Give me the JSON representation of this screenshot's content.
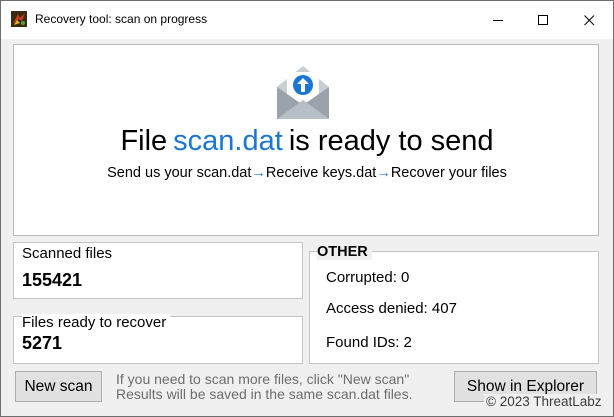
{
  "window": {
    "title": "Recovery tool: scan on progress"
  },
  "icons": {
    "app": "app-logo-icon",
    "minimize": "minimize-icon",
    "maximize": "maximize-icon",
    "close": "close-icon",
    "hero": "envelope-upload-icon"
  },
  "colors": {
    "accent": "#1a76d2",
    "window_bg": "#f0f0f0",
    "panel_bg": "#ffffff"
  },
  "hero": {
    "headline_prefix": "File",
    "filename": "scan.dat",
    "headline_suffix": "is ready to send",
    "step_1": "Send us your scan.dat",
    "arrow_1": "→",
    "step_2": "Receive keys.dat",
    "arrow_2": "→",
    "step_3": "Recover your files"
  },
  "stats": {
    "scanned_label": "Scanned files",
    "scanned_value": "155421",
    "ready_label": "Files ready to recover",
    "ready_value": "5271"
  },
  "other": {
    "title": "OTHER",
    "corrupted": "Corrupted: 0",
    "access_denied": "Access denied: 407",
    "found_ids": "Found IDs: 2"
  },
  "footer": {
    "new_scan_label": "New scan",
    "hint_line_1": "If you need to scan more files, click \"New scan\"",
    "hint_line_2": "Results will be saved in the same scan.dat files.",
    "explorer_label": "Show in Explorer",
    "copyright": "© 2023 ThreatLabz"
  }
}
